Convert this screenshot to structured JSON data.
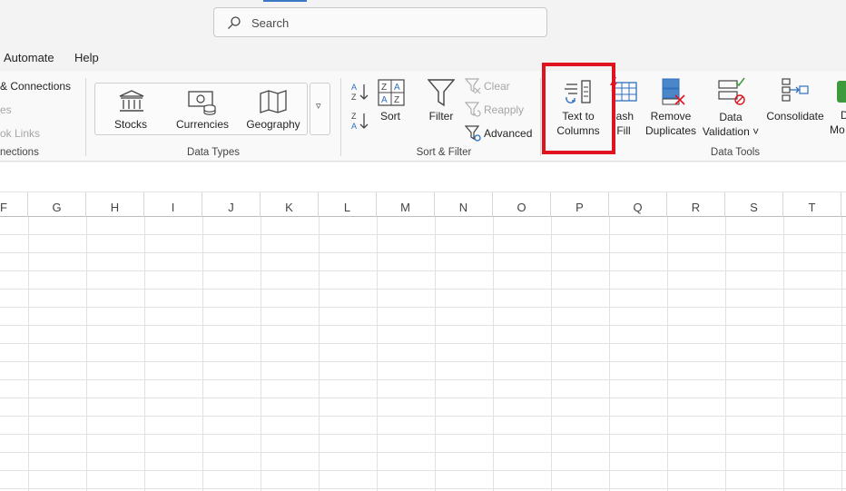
{
  "search": {
    "placeholder": "Search"
  },
  "menu": {
    "items": [
      "Automate",
      "Help"
    ]
  },
  "ribbon": {
    "get_data": {
      "queries_connections": "& Connections",
      "properties": "es",
      "workbook_links": "ok Links",
      "group_label": "nections"
    },
    "data_types": {
      "stocks": "Stocks",
      "currencies": "Currencies",
      "geography": "Geography",
      "more": "▿",
      "group_label": "Data Types"
    },
    "sort_filter": {
      "sort": "Sort",
      "filter": "Filter",
      "clear": "Clear",
      "reapply": "Reapply",
      "advanced": "Advanced",
      "group_label": "Sort & Filter"
    },
    "data_tools": {
      "text_to_columns_1": "Text to",
      "text_to_columns_2": "Columns",
      "flash_fill_1": "lash",
      "flash_fill_2": "Fill",
      "remove_dup_1": "Remove",
      "remove_dup_2": "Duplicates",
      "data_validation_1": "Data",
      "data_validation_2": "Validation ˅",
      "consolidate": "Consolidate",
      "data_model_1": "D",
      "data_model_2": "Mo",
      "group_label": "Data Tools"
    }
  },
  "columns": [
    "F",
    "G",
    "H",
    "I",
    "J",
    "K",
    "L",
    "M",
    "N",
    "O",
    "P",
    "Q",
    "R",
    "S",
    "T"
  ],
  "colors": {
    "highlight": "#e0141e",
    "accent": "#3b78c4"
  }
}
